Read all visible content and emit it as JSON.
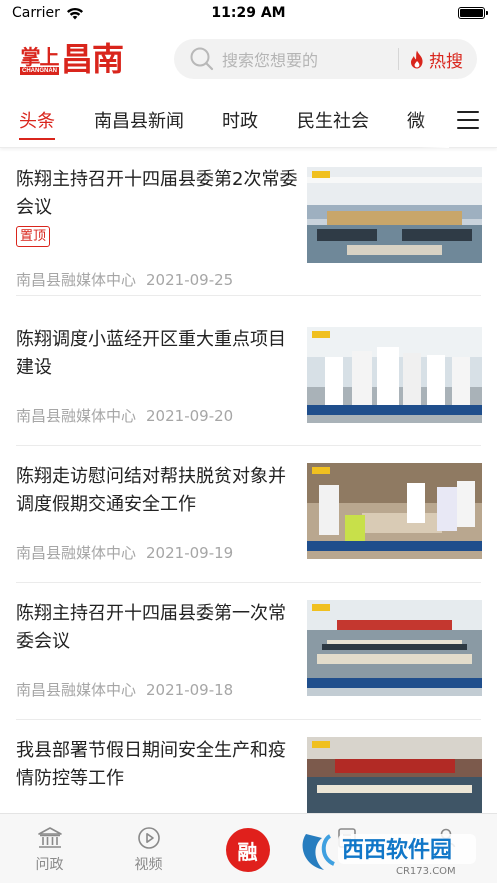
{
  "status_bar": {
    "carrier": "Carrier",
    "time": "11:29 AM",
    "battery_level": 1.0
  },
  "header": {
    "logo_small": "掌上",
    "logo_small_en": "CHANGNAN",
    "logo_big": "昌南",
    "search_placeholder": "搜索您想要的",
    "hot_search_label": "热搜"
  },
  "tabs": [
    {
      "label": "头条",
      "active": true
    },
    {
      "label": "南昌县新闻",
      "active": false
    },
    {
      "label": "时政",
      "active": false
    },
    {
      "label": "民生社会",
      "active": false
    },
    {
      "label": "微",
      "active": false
    }
  ],
  "articles": [
    {
      "title": "陈翔主持召开十四届县委第2次常委会议",
      "badge": "置顶",
      "source": "南昌县融媒体中心",
      "date": "2021-09-25"
    },
    {
      "title": "陈翔调度小蓝经开区重大重点项目建设",
      "source": "南昌县融媒体中心",
      "date": "2021-09-20"
    },
    {
      "title": "陈翔走访慰问结对帮扶脱贫对象并调度假期交通安全工作",
      "source": "南昌县融媒体中心",
      "date": "2021-09-19"
    },
    {
      "title": "陈翔主持召开十四届县委第一次常委会议",
      "source": "南昌县融媒体中心",
      "date": "2021-09-18"
    },
    {
      "title": "我县部署节假日期间安全生产和疫情防控等工作",
      "source": "",
      "date": ""
    }
  ],
  "bottom_nav": {
    "items": [
      {
        "label": "问政",
        "icon": "government-building-icon"
      },
      {
        "label": "视频",
        "icon": "play-circle-icon"
      },
      {
        "label": "融",
        "icon": "center-action"
      },
      {
        "label": "",
        "icon": "list-icon"
      },
      {
        "label": "",
        "icon": "user-icon"
      }
    ]
  },
  "watermark": {
    "text": "西西软件园",
    "sub": "CR173.COM"
  },
  "colors": {
    "accent": "#d9251c",
    "meta_text": "#a6a6a6",
    "nav_bg": "#f7f7f7"
  }
}
